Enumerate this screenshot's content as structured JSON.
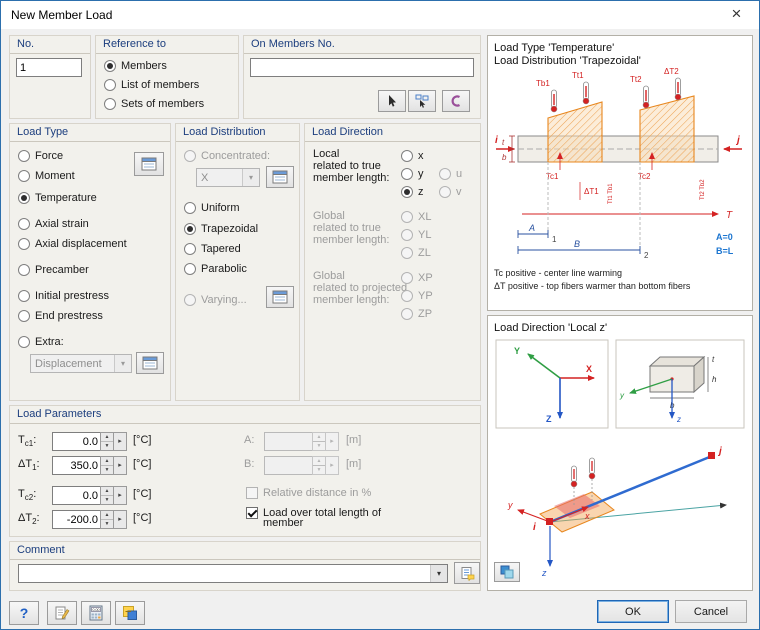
{
  "window": {
    "title": "New Member Load"
  },
  "icons": {
    "close": "×",
    "dropdown": "▾",
    "spin_up": "▲",
    "spin_down": "▼",
    "detail": "▸",
    "help": "?",
    "calc": "0.00"
  },
  "colors": {
    "accent": "#1f66b5",
    "caption": "#1c3e7e",
    "diagram_orange": "#e8871e",
    "diagram_red": "#d42222",
    "axis_green": "#2f9e44",
    "axis_blue": "#2457c5",
    "note_blue": "#1b75d0"
  },
  "no": {
    "caption": "No.",
    "value": "1"
  },
  "reference": {
    "caption": "Reference to",
    "opts": [
      "Members",
      "List of members",
      "Sets of members"
    ]
  },
  "on_members": {
    "caption": "On Members No.",
    "value": ""
  },
  "load_type": {
    "caption": "Load Type",
    "opts": [
      "Force",
      "Moment",
      "Temperature",
      "Axial strain",
      "Axial displacement",
      "Precamber",
      "Initial prestress",
      "End prestress",
      "Extra:"
    ],
    "extra_value": "Displacement"
  },
  "load_distribution": {
    "caption": "Load Distribution",
    "concentrated": "Concentrated:",
    "concentrated_value": "X",
    "opts": [
      "Uniform",
      "Trapezoidal",
      "Tapered",
      "Parabolic"
    ],
    "varying": "Varying..."
  },
  "load_direction": {
    "caption": "Load Direction",
    "local_label": [
      "Local",
      "related to true",
      "member length:"
    ],
    "local": [
      "x",
      "y",
      "z",
      "u",
      "v"
    ],
    "global_true_label": [
      "Global",
      "related to true",
      "member length:"
    ],
    "global_true": [
      "XL",
      "YL",
      "ZL"
    ],
    "global_proj_label": [
      "Global",
      "related to projected",
      "member length:"
    ],
    "global_proj": [
      "XP",
      "YP",
      "ZP"
    ]
  },
  "load_parameters": {
    "caption": "Load Parameters",
    "rows": [
      {
        "sym": "T",
        "sub": "c1",
        "colon": ":",
        "value": "0.0",
        "unit": "[°C]"
      },
      {
        "sym": "ΔT",
        "sub": "1",
        "colon": ":",
        "value": "350.0",
        "unit": "[°C]"
      },
      {
        "sym": "T",
        "sub": "c2",
        "colon": ":",
        "value": "0.0",
        "unit": "[°C]"
      },
      {
        "sym": "ΔT",
        "sub": "2",
        "colon": ":",
        "value": "-200.0",
        "unit": "[°C]"
      }
    ],
    "a_label": "A:",
    "b_label": "B:",
    "ab_unit": "[m]",
    "ab_value": "",
    "relative_label": "Relative distance in %",
    "total_label_1": "Load over total length of",
    "total_label_2": "member"
  },
  "comment": {
    "caption": "Comment",
    "value": ""
  },
  "footer": {
    "ok": "OK",
    "cancel": "Cancel"
  },
  "panel_top": {
    "title1": "Load Type 'Temperature'",
    "title2": "Load Distribution 'Trapezoidal'",
    "lbl": {
      "tb1": "Tb1",
      "tt1": "Tt1",
      "tt2": "Tt2",
      "dt2_top": "ΔT2",
      "tc1": "Tc1",
      "tc2": "Tc2",
      "dt1": "ΔT1",
      "rot1": "Tt1 Tb1",
      "rot2": "Tt2 Tb2",
      "t": "t",
      "b": "b",
      "i": "i",
      "j": "j",
      "T": "T",
      "A": "A",
      "B": "B",
      "n1": "1",
      "n2": "2",
      "a0": "A=0",
      "bl": "B=L"
    },
    "note1": "Tc positive - center line warming",
    "note2": "ΔT positive - top fibers warmer than bottom fibers"
  },
  "panel_bottom": {
    "title": "Load Direction 'Local z'",
    "axes": {
      "x": "X",
      "y": "Y",
      "z": "Z"
    },
    "section": {
      "t": "t",
      "h": "h",
      "b": "b",
      "y": "y",
      "z": "z"
    },
    "sketch": {
      "i": "i",
      "j": "j",
      "x": "x",
      "y": "y",
      "z": "z"
    }
  }
}
